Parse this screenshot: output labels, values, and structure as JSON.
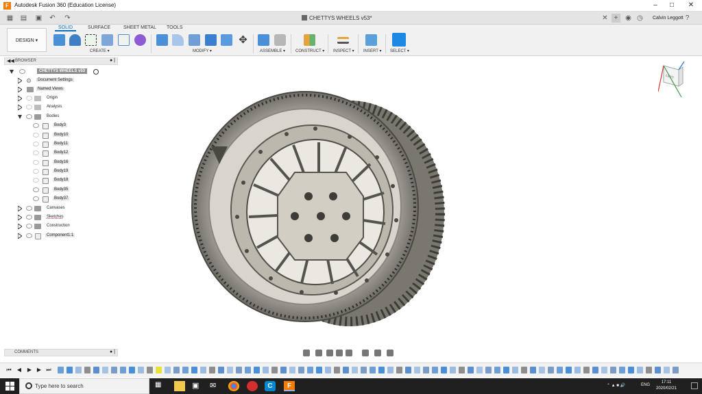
{
  "window": {
    "title": "Autodesk Fusion 360 (Education License)",
    "controls": [
      "minimize",
      "maximize",
      "close"
    ]
  },
  "doc_tab": {
    "title": "CHETTYS WHEELS v53*",
    "user": "Calvin Leggott"
  },
  "ribbon": {
    "workspace": "DESIGN",
    "tabs": [
      "SOLID",
      "SURFACE",
      "SHEET METAL",
      "TOOLS"
    ],
    "active_tab": "SOLID",
    "groups": [
      "CREATE",
      "MODIFY",
      "ASSEMBLE",
      "CONSTRUCT",
      "INSPECT",
      "INSERT",
      "SELECT"
    ]
  },
  "browser": {
    "title": "BROWSER",
    "root": "CHETTYS WHEELS v53",
    "items": [
      {
        "label": "Document Settings",
        "icon": "gear-icon"
      },
      {
        "label": "Named Views",
        "icon": "folder-icon"
      },
      {
        "label": "Origin",
        "icon": "folder-icon"
      },
      {
        "label": "Analysis",
        "icon": "folder-icon"
      },
      {
        "label": "Bodies",
        "icon": "folder-icon"
      },
      {
        "label": "Canvases",
        "icon": "folder-icon"
      },
      {
        "label": "Sketches",
        "icon": "folder-icon"
      },
      {
        "label": "Construction",
        "icon": "folder-icon"
      },
      {
        "label": "Component1:1",
        "icon": "component-icon"
      }
    ],
    "bodies": [
      "Body3",
      "Body10",
      "Body11",
      "Body12",
      "Body16",
      "Body19",
      "Body18",
      "Body35",
      "Body37"
    ]
  },
  "comments": {
    "title": "COMMENTS"
  },
  "viewcube": {
    "face": "LEFT"
  },
  "taskbar": {
    "search_placeholder": "Type here to search",
    "language": "ENG",
    "time": "17:11",
    "date": "2020/02/21"
  }
}
